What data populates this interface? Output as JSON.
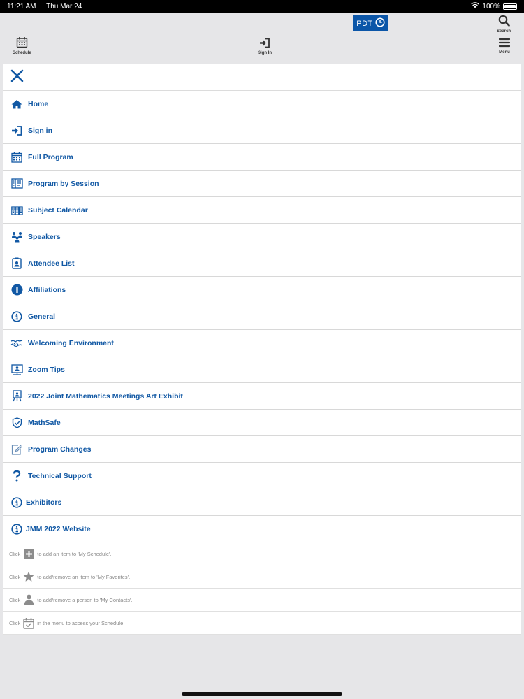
{
  "status": {
    "time": "11:21 AM",
    "date": "Thu Mar 24",
    "battery": "100%"
  },
  "toolbar": {
    "timezone": "PDT",
    "search_label": "Search",
    "schedule_label": "Schedule",
    "signin_label": "Sign In",
    "menu_label": "Menu"
  },
  "menu": {
    "items": [
      {
        "label": "Home",
        "icon": "home-icon"
      },
      {
        "label": "Sign in",
        "icon": "sign-in-icon"
      },
      {
        "label": "Full Program",
        "icon": "calendar-icon"
      },
      {
        "label": "Program by Session",
        "icon": "book-open-icon"
      },
      {
        "label": "Subject Calendar",
        "icon": "calendar-grid-icon"
      },
      {
        "label": "Speakers",
        "icon": "people-icon"
      },
      {
        "label": "Attendee List",
        "icon": "badge-icon"
      },
      {
        "label": "Affiliations",
        "icon": "info-solid-icon"
      },
      {
        "label": "General",
        "icon": "info-circle-icon"
      },
      {
        "label": "Welcoming Environment",
        "icon": "handshake-icon"
      },
      {
        "label": "Zoom Tips",
        "icon": "presenter-icon"
      },
      {
        "label": "2022 Joint Mathematics Meetings Art Exhibit",
        "icon": "easel-icon"
      },
      {
        "label": "MathSafe",
        "icon": "shield-icon"
      },
      {
        "label": "Program Changes",
        "icon": "edit-icon"
      },
      {
        "label": "Technical Support",
        "icon": "question-icon"
      },
      {
        "label": "Exhibitors",
        "icon": "info-circle-icon"
      },
      {
        "label": "JMM 2022 Website",
        "icon": "info-circle-icon"
      }
    ]
  },
  "hints": [
    {
      "prefix": "Click",
      "suffix": "to add an item to 'My Schedule'.",
      "icon": "plus-box-icon"
    },
    {
      "prefix": "Click",
      "suffix": "to add/remove an item to 'My Favorites'.",
      "icon": "star-icon"
    },
    {
      "prefix": "Click",
      "suffix": "to add/remove a person to 'My Contacts'.",
      "icon": "person-icon"
    },
    {
      "prefix": "Click",
      "suffix": "in the menu to access your Schedule",
      "icon": "calendar-check-icon"
    }
  ],
  "colors": {
    "accent": "#1158a4",
    "pdt_bg": "#0b56a8",
    "background": "#e6e6e8"
  }
}
